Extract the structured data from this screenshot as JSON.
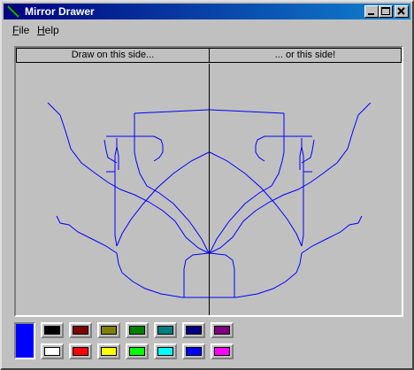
{
  "window": {
    "title": "Mirror Drawer"
  },
  "menu": [
    {
      "underline": "F",
      "rest": "ile"
    },
    {
      "underline": "H",
      "rest": "elp"
    }
  ],
  "canvas": {
    "left_header": "Draw on this side...",
    "right_header": "... or this side!",
    "stroke_color": "#0000ff"
  },
  "current_color": "#0000ff",
  "palette": [
    [
      "#000000",
      "#800000",
      "#808000",
      "#008000",
      "#008080",
      "#000080",
      "#800080"
    ],
    [
      "#ffffff",
      "#ff0000",
      "#ffff00",
      "#00ff00",
      "#00ffff",
      "#0000ff",
      "#ff00ff"
    ]
  ]
}
